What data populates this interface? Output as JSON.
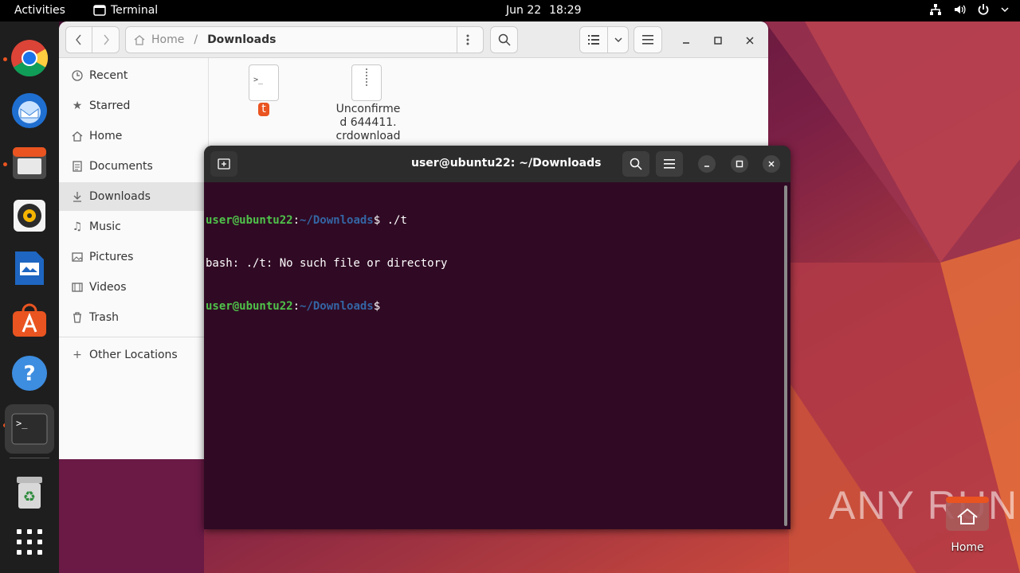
{
  "topbar": {
    "activities": "Activities",
    "app_name": "Terminal",
    "date": "Jun 22",
    "time": "18:29"
  },
  "dock": {
    "items": [
      "chrome-icon",
      "thunderbird-icon",
      "files-icon",
      "rhythmbox-icon",
      "libreoffice-writer-icon",
      "app-center-icon",
      "help-icon",
      "terminal-icon",
      "trash-icon",
      "show-apps-icon"
    ]
  },
  "files": {
    "path": {
      "home": "Home",
      "separator": "/",
      "current": "Downloads"
    },
    "sidebar": [
      "Recent",
      "Starred",
      "Home",
      "Documents",
      "Downloads",
      "Music",
      "Pictures",
      "Videos",
      "Trash",
      "Other Locations"
    ],
    "items": [
      {
        "name": "t",
        "type": "script"
      },
      {
        "name_lines": [
          "Unconfirme",
          "d 644411.",
          "crdownload"
        ],
        "type": "archive"
      }
    ]
  },
  "terminal": {
    "title": "user@ubuntu22: ~/Downloads",
    "lines": [
      {
        "user": "user@ubuntu22",
        "sep": ":",
        "path": "~/Downloads",
        "prompt": "$",
        "cmd": " ./t"
      },
      {
        "output": "bash: ./t: No such file or directory"
      },
      {
        "user": "user@ubuntu22",
        "sep": ":",
        "path": "~/Downloads",
        "prompt": "$",
        "cmd": ""
      }
    ]
  },
  "desktop": {
    "home_label": "Home",
    "watermark": "ANY RUN"
  },
  "colors": {
    "accent": "#e95420",
    "terminal_bg": "#300a24",
    "prompt_user": "#4fc24a",
    "prompt_path": "#3465a4"
  }
}
